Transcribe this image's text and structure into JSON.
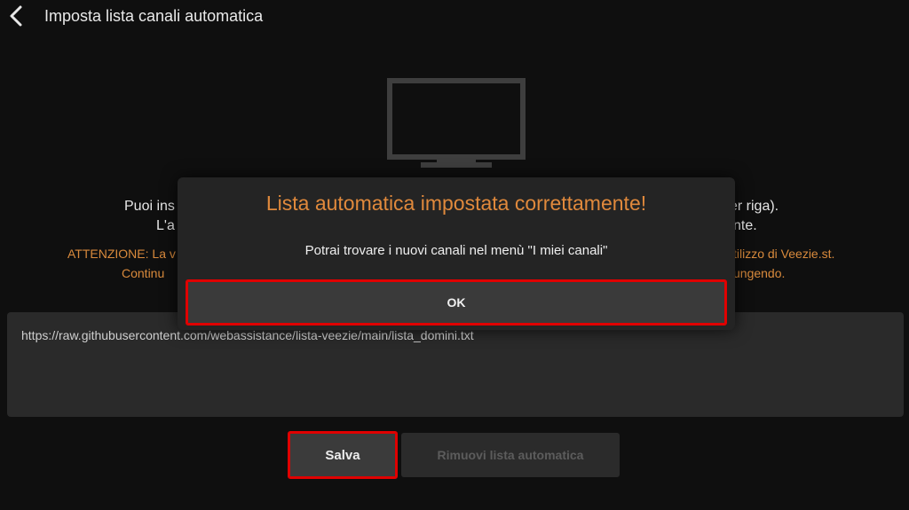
{
  "header": {
    "title": "Imposta lista canali automatica",
    "back_icon": "chevron-left-icon"
  },
  "illustration": {
    "icon": "tv-icon"
  },
  "info": {
    "line1_left": "Puoi ins",
    "line1_right": "er riga).",
    "line2_left": "L'a",
    "line2_right": "nte.",
    "warning1_left": "ATTENZIONE: La v",
    "warning1_right": "tilizzo di Veezie.st.",
    "warning2_left": "Continu",
    "warning2_right": "ungendo."
  },
  "url_field": {
    "value": "https://raw.githubusercontent.com/webassistance/lista-veezie/main/lista_domini.txt"
  },
  "buttons": {
    "save_label": "Salva",
    "remove_label": "Rimuovi lista automatica"
  },
  "dialog": {
    "title": "Lista automatica impostata correttamente!",
    "message": "Potrai trovare i nuovi canali nel menù \"I miei canali\"",
    "ok_label": "OK"
  },
  "colors": {
    "accent": "#e0893c",
    "highlight": "#e00000",
    "background": "#0f0f0f",
    "panel": "#242424"
  }
}
